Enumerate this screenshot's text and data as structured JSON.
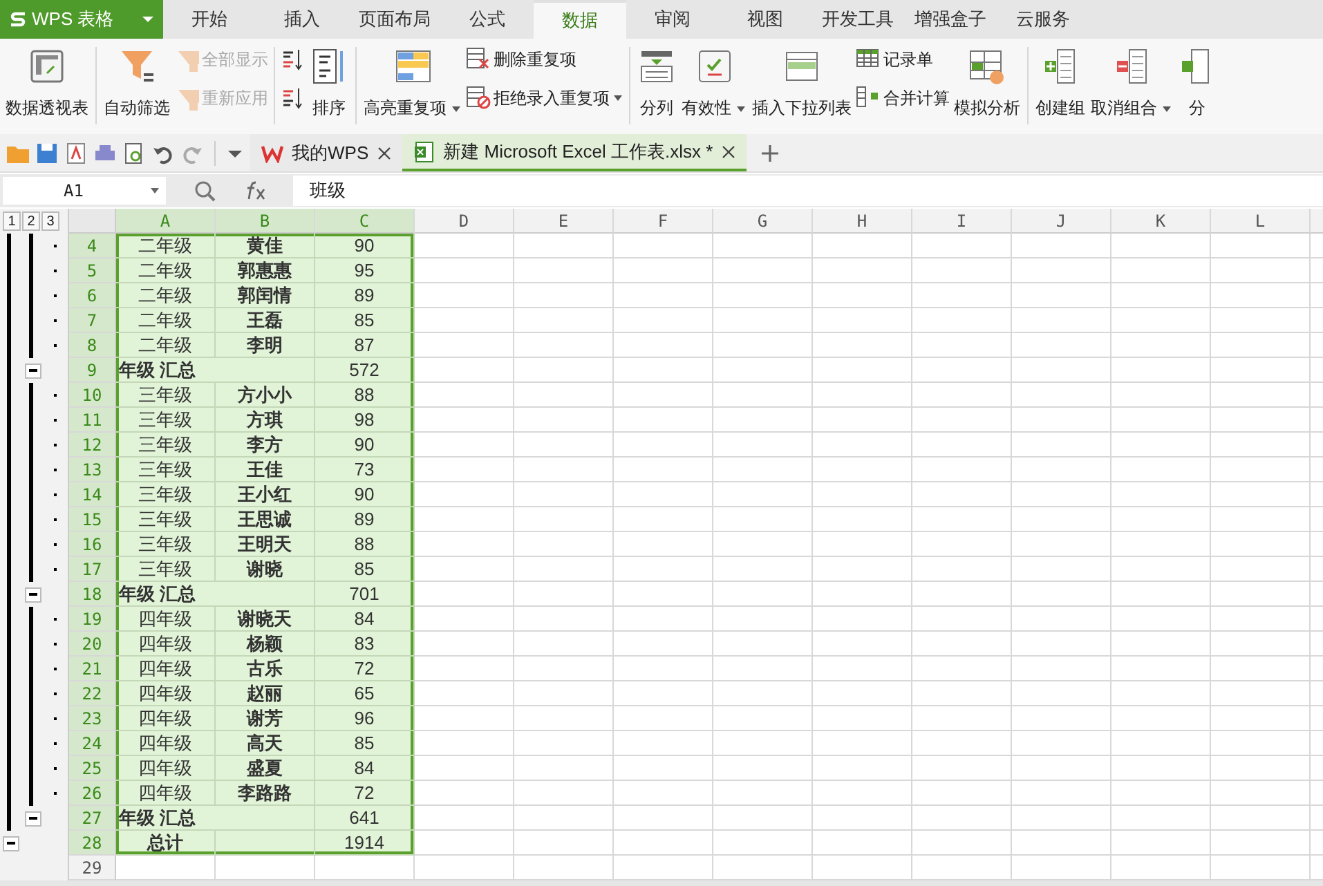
{
  "app_button": {
    "label": "WPS 表格"
  },
  "menu_tabs": [
    {
      "label": "开始",
      "selected": false
    },
    {
      "label": "插入",
      "selected": false
    },
    {
      "label": "页面布局",
      "selected": false
    },
    {
      "label": "公式",
      "selected": false
    },
    {
      "label": "数据",
      "selected": true
    },
    {
      "label": "审阅",
      "selected": false
    },
    {
      "label": "视图",
      "selected": false
    },
    {
      "label": "开发工具",
      "selected": false
    },
    {
      "label": "增强盒子",
      "selected": false
    },
    {
      "label": "云服务",
      "selected": false
    }
  ],
  "ribbon": [
    {
      "kind": "large",
      "label": "数据透视表",
      "dropdown": false
    },
    {
      "kind": "sep"
    },
    {
      "kind": "large",
      "label": "自动筛选",
      "dropdown": false
    },
    {
      "kind": "stack",
      "items": [
        {
          "label": "全部显示",
          "disabled": true,
          "dropdown": false
        },
        {
          "label": "重新应用",
          "disabled": true,
          "dropdown": false
        }
      ]
    },
    {
      "kind": "sep"
    },
    {
      "kind": "icons"
    },
    {
      "kind": "large",
      "label": "排序",
      "dropdown": false
    },
    {
      "kind": "sep"
    },
    {
      "kind": "large",
      "label": "高亮重复项",
      "dropdown": true
    },
    {
      "kind": "stack",
      "items": [
        {
          "label": "删除重复项",
          "disabled": false,
          "dropdown": false
        },
        {
          "label": "拒绝录入重复项",
          "disabled": false,
          "dropdown": true
        }
      ]
    },
    {
      "kind": "sep"
    },
    {
      "kind": "large",
      "label": "分列",
      "dropdown": false
    },
    {
      "kind": "large",
      "label": "有效性",
      "dropdown": true
    },
    {
      "kind": "large",
      "label": "插入下拉列表",
      "dropdown": false
    },
    {
      "kind": "stack",
      "items": [
        {
          "label": "记录单",
          "disabled": false,
          "dropdown": false
        },
        {
          "label": "合并计算",
          "disabled": false,
          "dropdown": false
        }
      ]
    },
    {
      "kind": "large",
      "label": "模拟分析",
      "dropdown": false
    },
    {
      "kind": "sep"
    },
    {
      "kind": "large",
      "label": "创建组",
      "dropdown": false
    },
    {
      "kind": "large",
      "label": "取消组合",
      "dropdown": true
    },
    {
      "kind": "large",
      "label": "分",
      "dropdown": false
    }
  ],
  "doc_tabs": [
    {
      "label": "我的WPS",
      "selected": false
    },
    {
      "label": "新建 Microsoft Excel 工作表.xlsx *",
      "selected": true
    }
  ],
  "formula_bar": {
    "name_box": "A1",
    "content": "班级"
  },
  "outline_levels": [
    "1",
    "2",
    "3"
  ],
  "columns": [
    {
      "label": "A",
      "selected": true
    },
    {
      "label": "B",
      "selected": true
    },
    {
      "label": "C",
      "selected": true
    },
    {
      "label": "D",
      "selected": false
    },
    {
      "label": "E",
      "selected": false
    },
    {
      "label": "F",
      "selected": false
    },
    {
      "label": "G",
      "selected": false
    },
    {
      "label": "H",
      "selected": false
    },
    {
      "label": "I",
      "selected": false
    },
    {
      "label": "J",
      "selected": false
    },
    {
      "label": "K",
      "selected": false
    },
    {
      "label": "L",
      "selected": false
    }
  ],
  "rows": [
    {
      "header": "4",
      "kind": "detail",
      "selected": true,
      "cells": [
        "二年级",
        "黄佳",
        "90"
      ]
    },
    {
      "header": "5",
      "kind": "detail",
      "selected": true,
      "cells": [
        "二年级",
        "郭惠惠",
        "95"
      ]
    },
    {
      "header": "6",
      "kind": "detail",
      "selected": true,
      "cells": [
        "二年级",
        "郭闰情",
        "89"
      ]
    },
    {
      "header": "7",
      "kind": "detail",
      "selected": true,
      "cells": [
        "二年级",
        "王磊",
        "85"
      ]
    },
    {
      "header": "8",
      "kind": "detail",
      "selected": true,
      "cells": [
        "二年级",
        "李明",
        "87"
      ]
    },
    {
      "header": "9",
      "kind": "subtotal",
      "selected": true,
      "label": "年级 汇总",
      "value": "572"
    },
    {
      "header": "10",
      "kind": "detail",
      "selected": true,
      "cells": [
        "三年级",
        "方小小",
        "88"
      ]
    },
    {
      "header": "11",
      "kind": "detail",
      "selected": true,
      "cells": [
        "三年级",
        "方琪",
        "98"
      ]
    },
    {
      "header": "12",
      "kind": "detail",
      "selected": true,
      "cells": [
        "三年级",
        "李方",
        "90"
      ]
    },
    {
      "header": "13",
      "kind": "detail",
      "selected": true,
      "cells": [
        "三年级",
        "王佳",
        "73"
      ]
    },
    {
      "header": "14",
      "kind": "detail",
      "selected": true,
      "cells": [
        "三年级",
        "王小红",
        "90"
      ]
    },
    {
      "header": "15",
      "kind": "detail",
      "selected": true,
      "cells": [
        "三年级",
        "王思诚",
        "89"
      ]
    },
    {
      "header": "16",
      "kind": "detail",
      "selected": true,
      "cells": [
        "三年级",
        "王明天",
        "88"
      ]
    },
    {
      "header": "17",
      "kind": "detail",
      "selected": true,
      "cells": [
        "三年级",
        "谢晓",
        "85"
      ]
    },
    {
      "header": "18",
      "kind": "subtotal",
      "selected": true,
      "label": "年级 汇总",
      "value": "701"
    },
    {
      "header": "19",
      "kind": "detail",
      "selected": true,
      "cells": [
        "四年级",
        "谢晓天",
        "84"
      ]
    },
    {
      "header": "20",
      "kind": "detail",
      "selected": true,
      "cells": [
        "四年级",
        "杨颖",
        "83"
      ]
    },
    {
      "header": "21",
      "kind": "detail",
      "selected": true,
      "cells": [
        "四年级",
        "古乐",
        "72"
      ]
    },
    {
      "header": "22",
      "kind": "detail",
      "selected": true,
      "cells": [
        "四年级",
        "赵丽",
        "65"
      ]
    },
    {
      "header": "23",
      "kind": "detail",
      "selected": true,
      "cells": [
        "四年级",
        "谢芳",
        "96"
      ]
    },
    {
      "header": "24",
      "kind": "detail",
      "selected": true,
      "cells": [
        "四年级",
        "高天",
        "85"
      ]
    },
    {
      "header": "25",
      "kind": "detail",
      "selected": true,
      "cells": [
        "四年级",
        "盛夏",
        "84"
      ]
    },
    {
      "header": "26",
      "kind": "detail",
      "selected": true,
      "cells": [
        "四年级",
        "李路路",
        "72"
      ]
    },
    {
      "header": "27",
      "kind": "subtotal",
      "selected": true,
      "label": "年级 汇总",
      "value": "641"
    },
    {
      "header": "28",
      "kind": "total",
      "selected": true,
      "label": "总计",
      "value": "1914"
    },
    {
      "header": "29",
      "kind": "empty",
      "selected": false
    }
  ]
}
